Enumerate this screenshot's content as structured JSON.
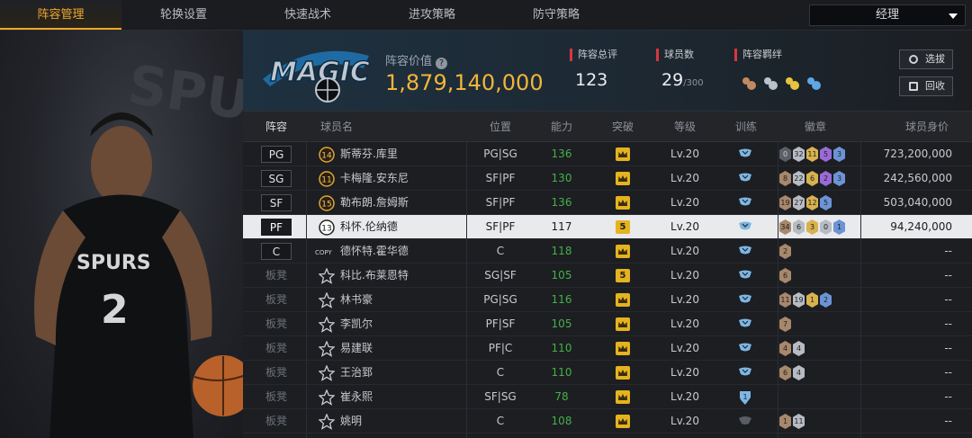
{
  "tabs": [
    "阵容管理",
    "轮换设置",
    "快速战术",
    "进攻策略",
    "防守策略"
  ],
  "manager": {
    "label": "经理"
  },
  "header": {
    "value_label": "阵容价值",
    "value": "1,879,140,000",
    "rating_label": "阵容总评",
    "rating": "123",
    "count_label": "球员数",
    "count": "29",
    "count_max": "/300",
    "chem_label": "阵容羁绊",
    "btn_select": "选拔",
    "btn_recycle": "回收",
    "team_logo_text": "MAGIC"
  },
  "columns": {
    "lineup": "阵容",
    "name": "球员名",
    "position": "位置",
    "ability": "能力",
    "breakthrough": "突破",
    "level": "等级",
    "training": "训练",
    "badges": "徽章",
    "salary": "球员身价"
  },
  "colors": {
    "accent": "#f0a72c",
    "ability_green": "#45b046",
    "value_gold": "#f2b43a"
  },
  "players": [
    {
      "slot": "PG",
      "num": "14",
      "name": "斯蒂芬.库里",
      "pos": "PG|SG",
      "ability": "136",
      "brk": "crown",
      "level": "Lv.20",
      "train": "cup",
      "badges": [
        {
          "c": "dk",
          "t": "0"
        },
        {
          "c": "si",
          "t": "32"
        },
        {
          "c": "go",
          "t": "11"
        },
        {
          "c": "pu",
          "t": "5"
        },
        {
          "c": "bl",
          "t": "3"
        }
      ],
      "salary": "723,200,000"
    },
    {
      "slot": "SG",
      "num": "11",
      "name": "卡梅隆.安东尼",
      "pos": "SF|PF",
      "ability": "130",
      "brk": "crown",
      "level": "Lv.20",
      "train": "cup",
      "badges": [
        {
          "c": "br",
          "t": "8"
        },
        {
          "c": "si",
          "t": "22"
        },
        {
          "c": "go",
          "t": "6"
        },
        {
          "c": "pu",
          "t": "2"
        },
        {
          "c": "bl",
          "t": "3"
        }
      ],
      "salary": "242,560,000"
    },
    {
      "slot": "SF",
      "num": "15",
      "name": "勒布朗.詹姆斯",
      "pos": "SF|PF",
      "ability": "136",
      "brk": "crown",
      "level": "Lv.20",
      "train": "cup",
      "badges": [
        {
          "c": "br",
          "t": "19"
        },
        {
          "c": "si",
          "t": "27"
        },
        {
          "c": "go",
          "t": "12"
        },
        {
          "c": "bl",
          "t": "5"
        }
      ],
      "salary": "503,040,000"
    },
    {
      "slot": "PF",
      "num": "13",
      "name": "科怀.伦纳德",
      "pos": "SF|PF",
      "ability": "117",
      "brk": "5",
      "level": "Lv.20",
      "train": "cup",
      "badges": [
        {
          "c": "br",
          "t": "34"
        },
        {
          "c": "si",
          "t": "6"
        },
        {
          "c": "go",
          "t": "3"
        },
        {
          "c": "si",
          "t": "0"
        },
        {
          "c": "bl",
          "t": "1"
        }
      ],
      "salary": "94,240,000",
      "hl": true
    },
    {
      "slot": "C",
      "num": "COPY",
      "name": "德怀特.霍华德",
      "pos": "C",
      "ability": "118",
      "brk": "crown",
      "level": "Lv.20",
      "train": "cup",
      "badges": [
        {
          "c": "br",
          "t": "2"
        }
      ],
      "salary": "--"
    },
    {
      "slot": "板凳",
      "num": "★",
      "name": "科比.布莱恩特",
      "pos": "SG|SF",
      "ability": "105",
      "brk": "5",
      "level": "Lv.20",
      "train": "cup",
      "badges": [
        {
          "c": "br",
          "t": "6"
        }
      ],
      "salary": "--"
    },
    {
      "slot": "板凳",
      "num": "★",
      "name": "林书豪",
      "pos": "PG|SG",
      "ability": "116",
      "brk": "crown",
      "level": "Lv.20",
      "train": "cup",
      "badges": [
        {
          "c": "br",
          "t": "11"
        },
        {
          "c": "si",
          "t": "19"
        },
        {
          "c": "go",
          "t": "1"
        },
        {
          "c": "bl",
          "t": "2"
        }
      ],
      "salary": "--"
    },
    {
      "slot": "板凳",
      "num": "★",
      "name": "李凯尔",
      "pos": "PF|SF",
      "ability": "105",
      "brk": "crown",
      "level": "Lv.20",
      "train": "cup",
      "badges": [
        {
          "c": "br",
          "t": "7"
        }
      ],
      "salary": "--"
    },
    {
      "slot": "板凳",
      "num": "★",
      "name": "易建联",
      "pos": "PF|C",
      "ability": "110",
      "brk": "crown",
      "level": "Lv.20",
      "train": "cup",
      "badges": [
        {
          "c": "br",
          "t": "4"
        },
        {
          "c": "si",
          "t": "4"
        }
      ],
      "salary": "--"
    },
    {
      "slot": "板凳",
      "num": "★",
      "name": "王治郅",
      "pos": "C",
      "ability": "110",
      "brk": "crown",
      "level": "Lv.20",
      "train": "cup",
      "badges": [
        {
          "c": "br",
          "t": "6"
        },
        {
          "c": "si",
          "t": "4"
        }
      ],
      "salary": "--"
    },
    {
      "slot": "板凳",
      "num": "★",
      "name": "崔永熙",
      "pos": "SF|SG",
      "ability": "78",
      "brk": "crown",
      "level": "Lv.20",
      "train": "shield1",
      "badges": [],
      "salary": "--"
    },
    {
      "slot": "板凳",
      "num": "★",
      "name": "姚明",
      "pos": "C",
      "ability": "108",
      "brk": "crown",
      "level": "Lv.20",
      "train": "dark",
      "badges": [
        {
          "c": "br",
          "t": "1"
        },
        {
          "c": "si",
          "t": "11"
        }
      ],
      "salary": "--"
    }
  ]
}
